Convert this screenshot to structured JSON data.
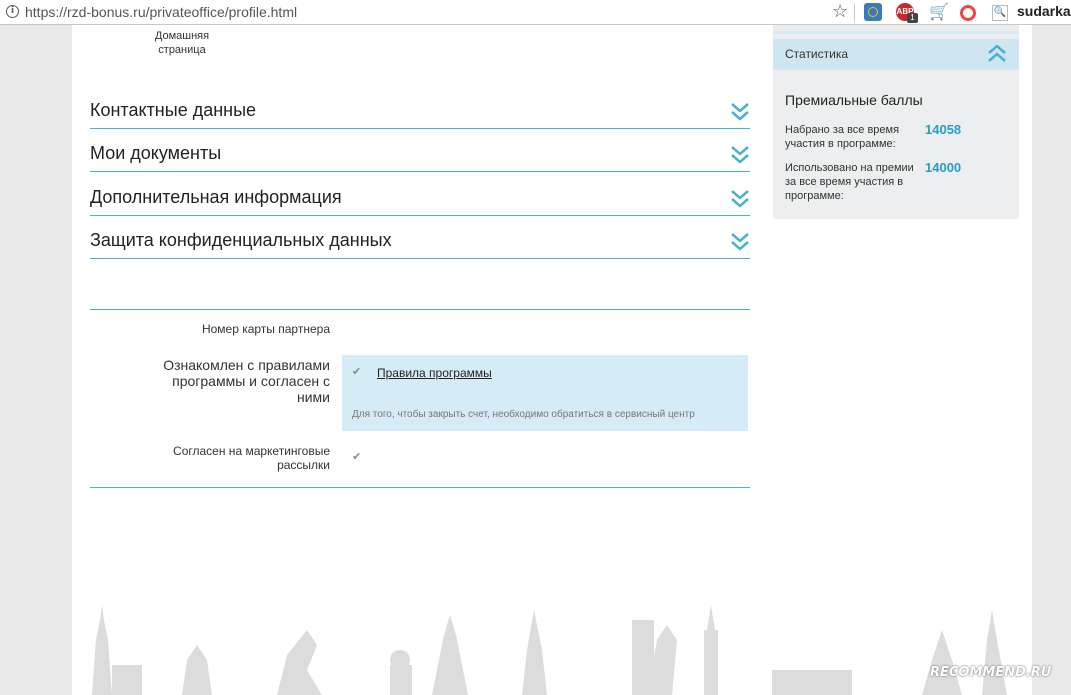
{
  "browser": {
    "url": "https://rzd-bonus.ru/privateoffice/profile.html",
    "user": "sudarka",
    "abp_badge": "1",
    "abp_label": "ABP"
  },
  "page": {
    "home_label": "Домашняя страница",
    "sections": [
      {
        "title": "Контактные данные"
      },
      {
        "title": "Мои документы"
      },
      {
        "title": "Дополнительная информация"
      },
      {
        "title": "Защита конфиденциальных данных"
      }
    ],
    "form": {
      "partner_card_label": "Номер карты партнера",
      "rules_label": "Ознакомлен с правилами программы и согласен с ними",
      "rules_link": "Правила программы",
      "rules_note": "Для того, чтобы закрыть счет, необходимо обратиться в сервисный центр",
      "marketing_label": "Согласен на маркетинговые рассылки",
      "check_glyph": "✔"
    }
  },
  "stats": {
    "header": "Статистика",
    "points_title": "Премиальные баллы",
    "rows": [
      {
        "label": "Набрано за все время участия в программе:",
        "value": "14058"
      },
      {
        "label": "Использовано на премии за все время участия в программе:",
        "value": "14000"
      }
    ]
  },
  "watermark": "RECOMMEND.RU",
  "colors": {
    "accent": "#4ab1cf",
    "value_blue": "#2b9cc9",
    "highlight_bg": "#d5ecf6"
  }
}
